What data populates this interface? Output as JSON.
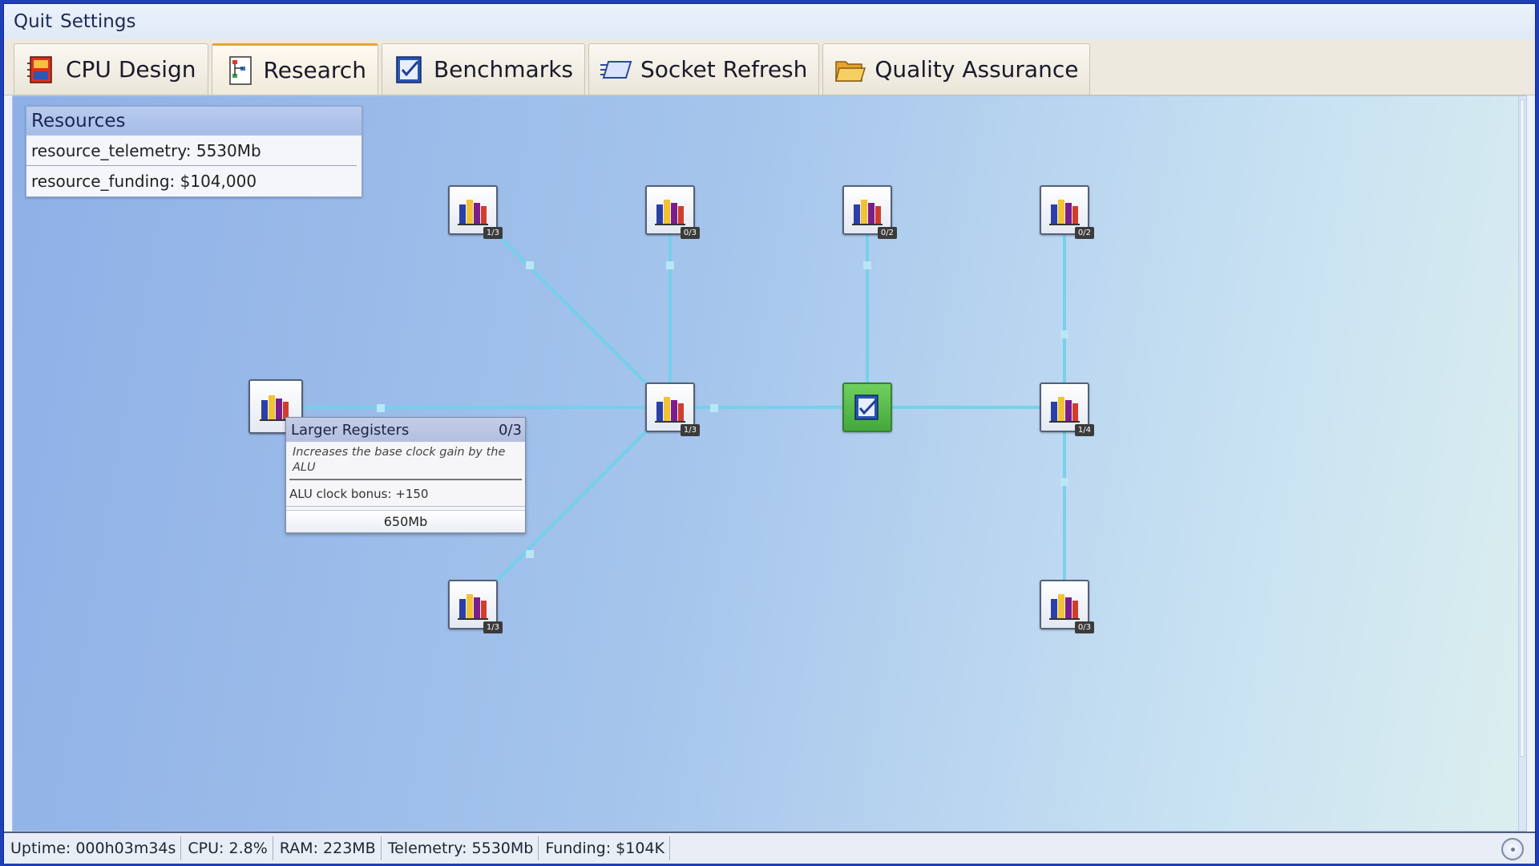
{
  "menu": {
    "items": [
      "Quit",
      "Settings"
    ]
  },
  "tabs": [
    {
      "label": "CPU Design",
      "icon": "cpu-chip-icon",
      "active": false
    },
    {
      "label": "Research",
      "icon": "research-tree-icon",
      "active": true
    },
    {
      "label": "Benchmarks",
      "icon": "benchmark-check-icon",
      "active": false
    },
    {
      "label": "Socket Refresh",
      "icon": "socket-icon",
      "active": false
    },
    {
      "label": "Quality Assurance",
      "icon": "folder-icon",
      "active": false
    }
  ],
  "resources": {
    "title": "Resources",
    "telemetry": "resource_telemetry: 5530Mb",
    "funding": "resource_funding: $104,000"
  },
  "nodes": [
    {
      "id": "n-hover",
      "progress": "",
      "icon": "books-icon",
      "hovered": true
    },
    {
      "id": "n-top1",
      "progress": "1/3",
      "icon": "books-icon"
    },
    {
      "id": "n-top2",
      "progress": "0/3",
      "icon": "books-icon"
    },
    {
      "id": "n-top3",
      "progress": "0/2",
      "icon": "books-icon"
    },
    {
      "id": "n-top4",
      "progress": "0/2",
      "icon": "books-icon"
    },
    {
      "id": "n-mid",
      "progress": "1/3",
      "icon": "books-icon"
    },
    {
      "id": "n-root",
      "progress": "",
      "icon": "checklist-icon",
      "completed": true
    },
    {
      "id": "n-right",
      "progress": "1/4",
      "icon": "books-icon"
    },
    {
      "id": "n-bot1",
      "progress": "1/3",
      "icon": "books-icon"
    },
    {
      "id": "n-bot2",
      "progress": "0/3",
      "icon": "books-icon"
    }
  ],
  "tooltip": {
    "title": "Larger Registers",
    "progress": "0/3",
    "description": "Increases the base clock gain by the ALU",
    "stat": "ALU clock bonus: +150",
    "cost": "650Mb"
  },
  "status": {
    "uptime": "Uptime: 000h03m34s",
    "cpu": "CPU: 2.8%",
    "ram": "RAM: 223MB",
    "telemetry": "Telemetry: 5530Mb",
    "funding": "Funding: $104K"
  },
  "colors": {
    "link": "#6fd2ea",
    "completed": "#4cae3f",
    "active_tab_accent": "#e3a53a"
  }
}
